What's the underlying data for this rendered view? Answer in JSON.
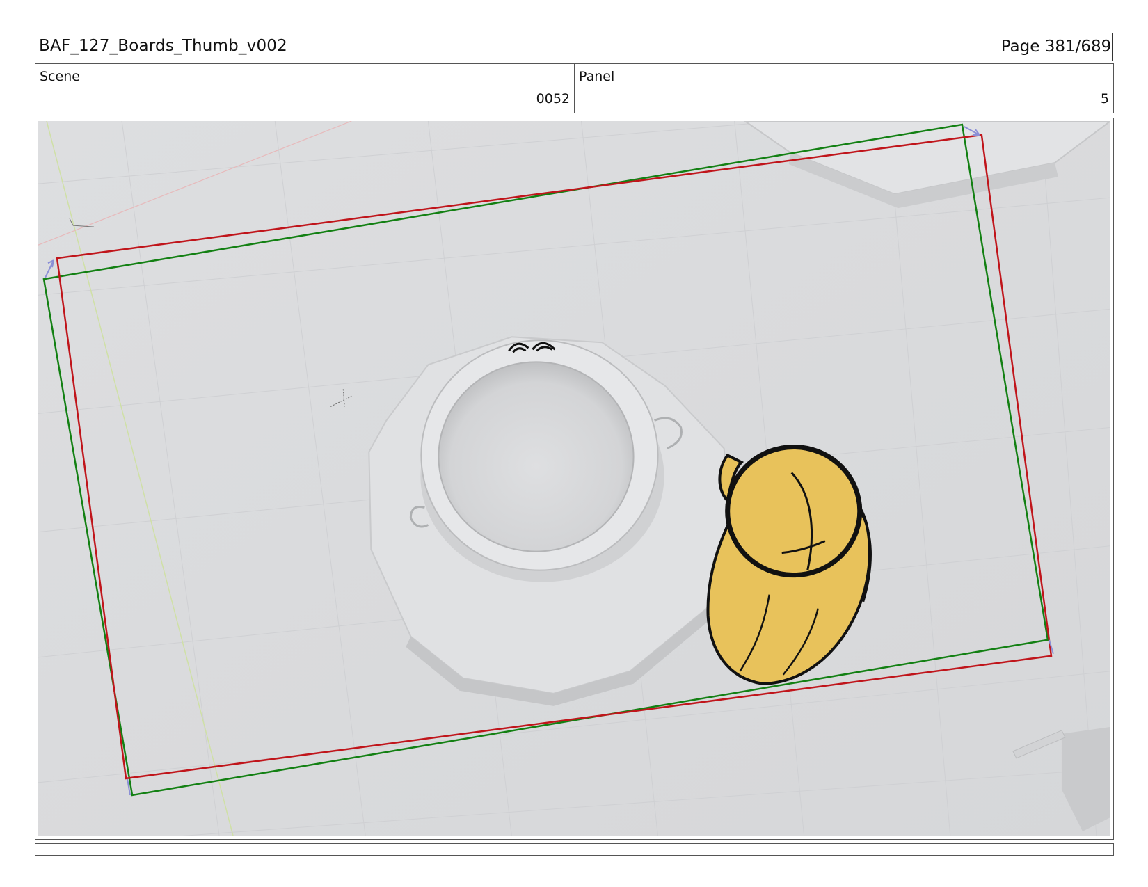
{
  "document": {
    "title": "BAF_127_Boards_Thumb_v002",
    "page": "Page 381/689"
  },
  "info": {
    "scene_label": "Scene",
    "scene_value": "0052",
    "panel_label": "Panel",
    "panel_value": "5"
  },
  "panel": {
    "background_color": "#d9dadc",
    "safe_frame_color": "#138013",
    "camera_frame_color": "#c0151b",
    "character_fill_color": "#e8c25b",
    "icons": [
      "cauldron-icon",
      "character-head-icon"
    ]
  },
  "caption": ""
}
